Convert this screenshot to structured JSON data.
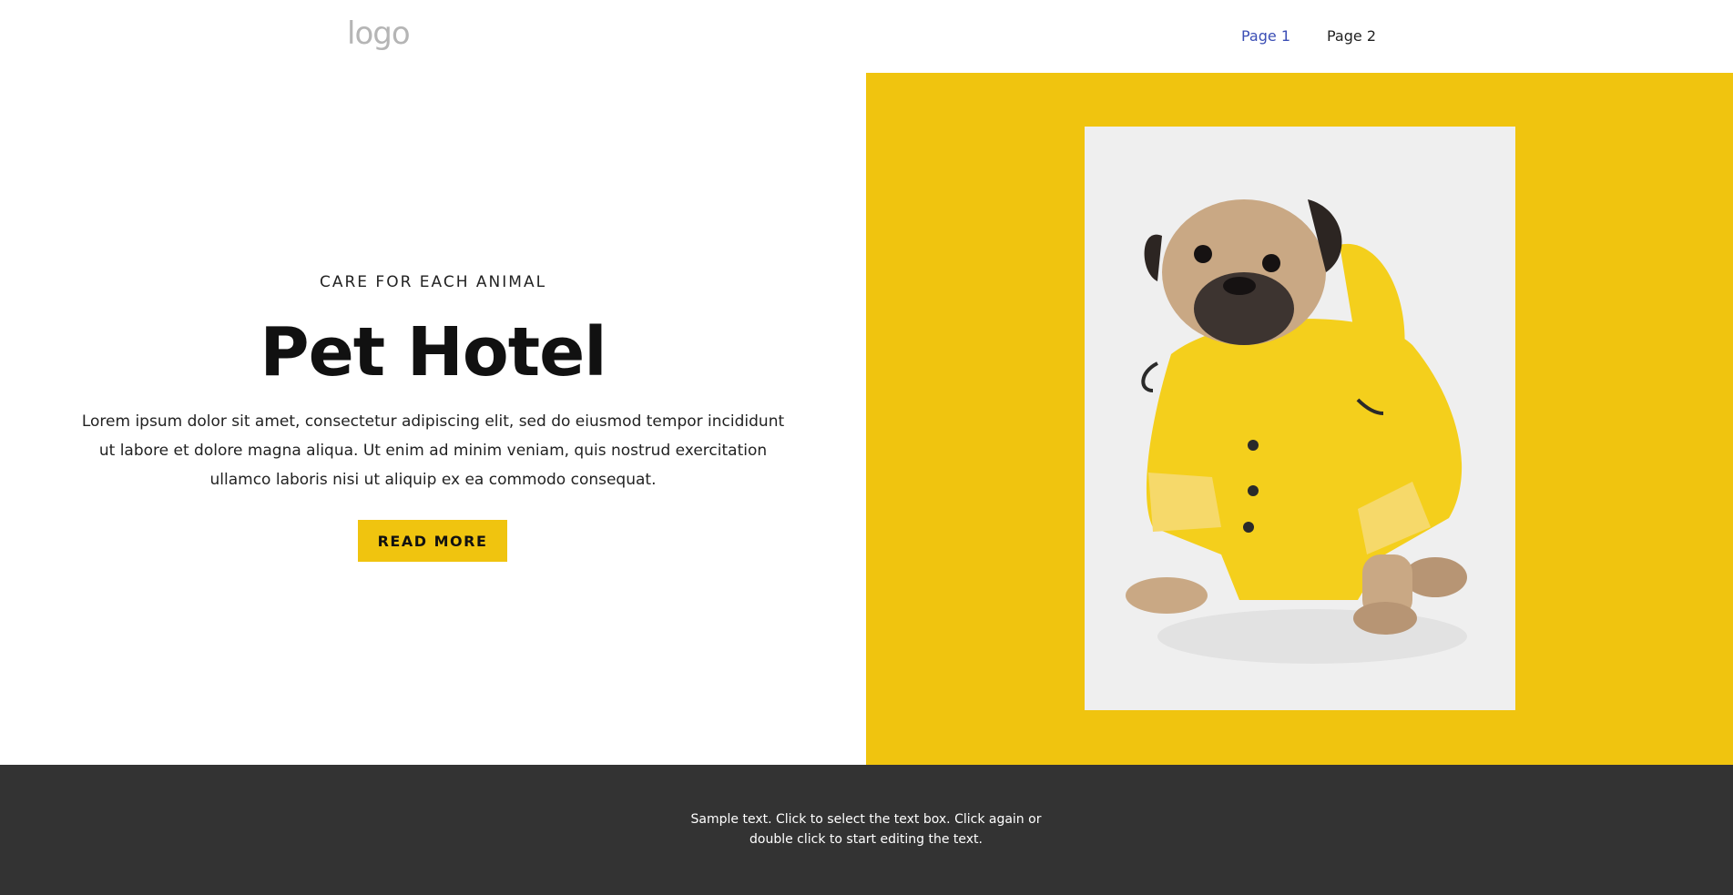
{
  "header": {
    "logo": "logo",
    "nav": [
      {
        "label": "Page 1",
        "active": true
      },
      {
        "label": "Page 2",
        "active": false
      }
    ]
  },
  "hero": {
    "eyebrow": "CARE FOR EACH ANIMAL",
    "title": "Pet Hotel",
    "body": "Lorem ipsum dolor sit amet, consectetur adipiscing elit, sed do eiusmod tempor incididunt ut labore et dolore magna aliqua. Ut enim ad minim veniam, quis nostrud exercitation ullamco laboris nisi ut aliquip ex ea commodo consequat.",
    "button_label": "READ MORE",
    "image_icon": "pug-in-yellow-raincoat-photo"
  },
  "footer": {
    "text": "Sample text. Click to select the text box. Click again or double click to start editing the text."
  },
  "colors": {
    "accent": "#f0c40f",
    "nav_active": "#3b4eb5",
    "footer_bg": "#333333",
    "logo": "#b5b5b5"
  }
}
